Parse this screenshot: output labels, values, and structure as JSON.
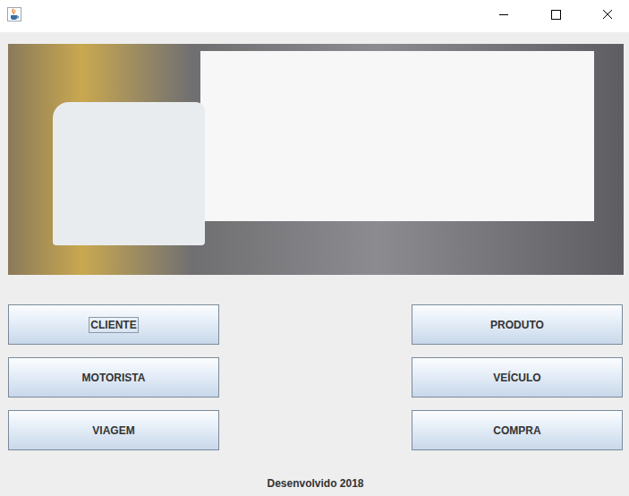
{
  "buttons": [
    {
      "label": "CLIENTE",
      "focused": true
    },
    {
      "label": "PRODUTO",
      "focused": false
    },
    {
      "label": "MOTORISTA",
      "focused": false
    },
    {
      "label": "VEÍCULO",
      "focused": false
    },
    {
      "label": "VIAGEM",
      "focused": false
    },
    {
      "label": "COMPRA",
      "focused": false
    }
  ],
  "footer": "Desenvolvido 2018"
}
